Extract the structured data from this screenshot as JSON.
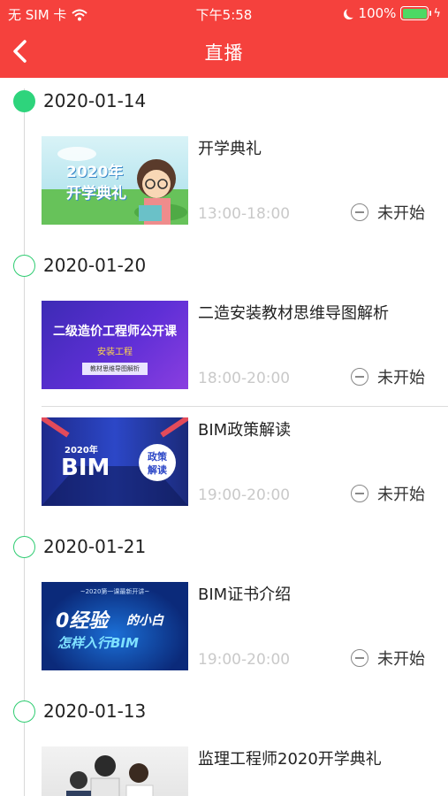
{
  "status_bar": {
    "carrier": "无 SIM 卡",
    "time": "下午5:58",
    "battery": "100%",
    "battery_level": 1.0
  },
  "header": {
    "title": "直播"
  },
  "groups": [
    {
      "date": "2020-01-14",
      "active": true,
      "items": [
        {
          "name": "开学典礼",
          "time": "13:00-18:00",
          "status": "未开始",
          "thumb": {
            "line1": "2020年",
            "line2": "开学典礼"
          }
        }
      ]
    },
    {
      "date": "2020-01-20",
      "active": false,
      "items": [
        {
          "name": "二造安装教材思维导图解析",
          "time": "18:00-20:00",
          "status": "未开始",
          "thumb": {
            "line1": "二级造价工程师公开课",
            "line2": "安装工程",
            "line3": "教材思维导图解析"
          }
        },
        {
          "name": "BIM政策解读",
          "time": "19:00-20:00",
          "status": "未开始",
          "thumb": {
            "line1": "2020年",
            "line2": "BIM",
            "line3": "政策",
            "line4": "解读"
          }
        }
      ]
    },
    {
      "date": "2020-01-21",
      "active": false,
      "items": [
        {
          "name": "BIM证书介绍",
          "time": "19:00-20:00",
          "status": "未开始",
          "thumb": {
            "line1": "~2020第一课最新开讲~",
            "line2": "0经验",
            "line3": "的小白",
            "line4": "怎样入行BIM"
          }
        }
      ]
    },
    {
      "date": "2020-01-13",
      "active": false,
      "items": [
        {
          "name": "监理工程师2020开学典礼"
        }
      ]
    }
  ]
}
